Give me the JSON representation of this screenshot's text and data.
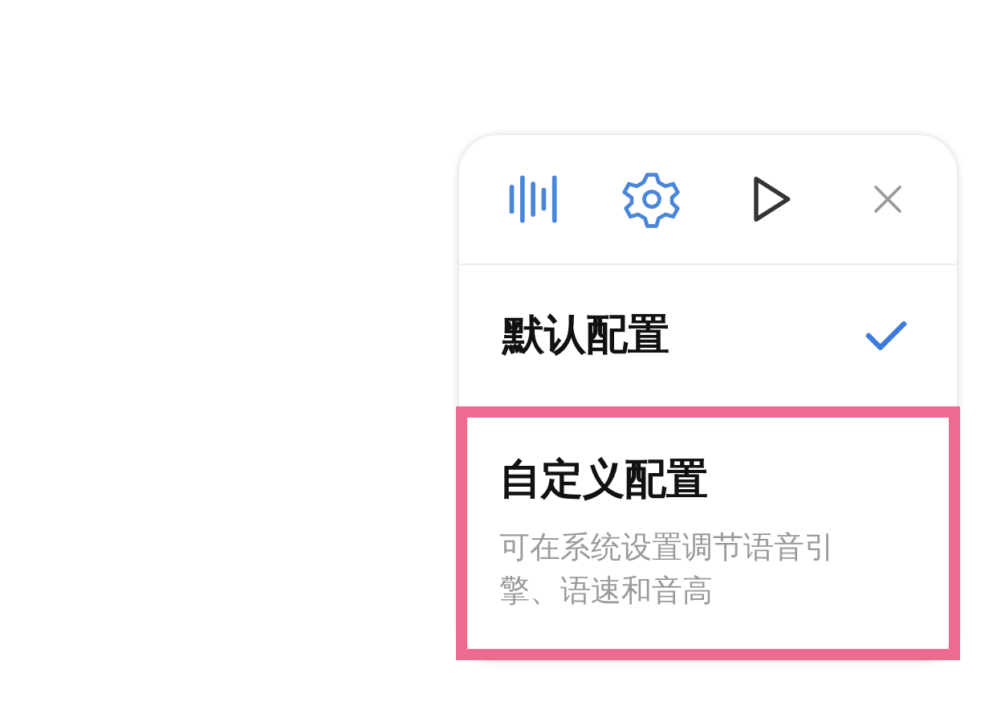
{
  "toolbar": [
    {
      "kind": "waveform"
    },
    {
      "kind": "settings"
    },
    {
      "kind": "play"
    },
    {
      "kind": "close"
    }
  ],
  "options": [
    {
      "title": "默认配置",
      "selected": true,
      "highlighted": false
    },
    {
      "title": "自定义配置",
      "description": "可在系统设置调节语音引擎、语速和音高",
      "selected": false,
      "highlighted": true
    }
  ]
}
